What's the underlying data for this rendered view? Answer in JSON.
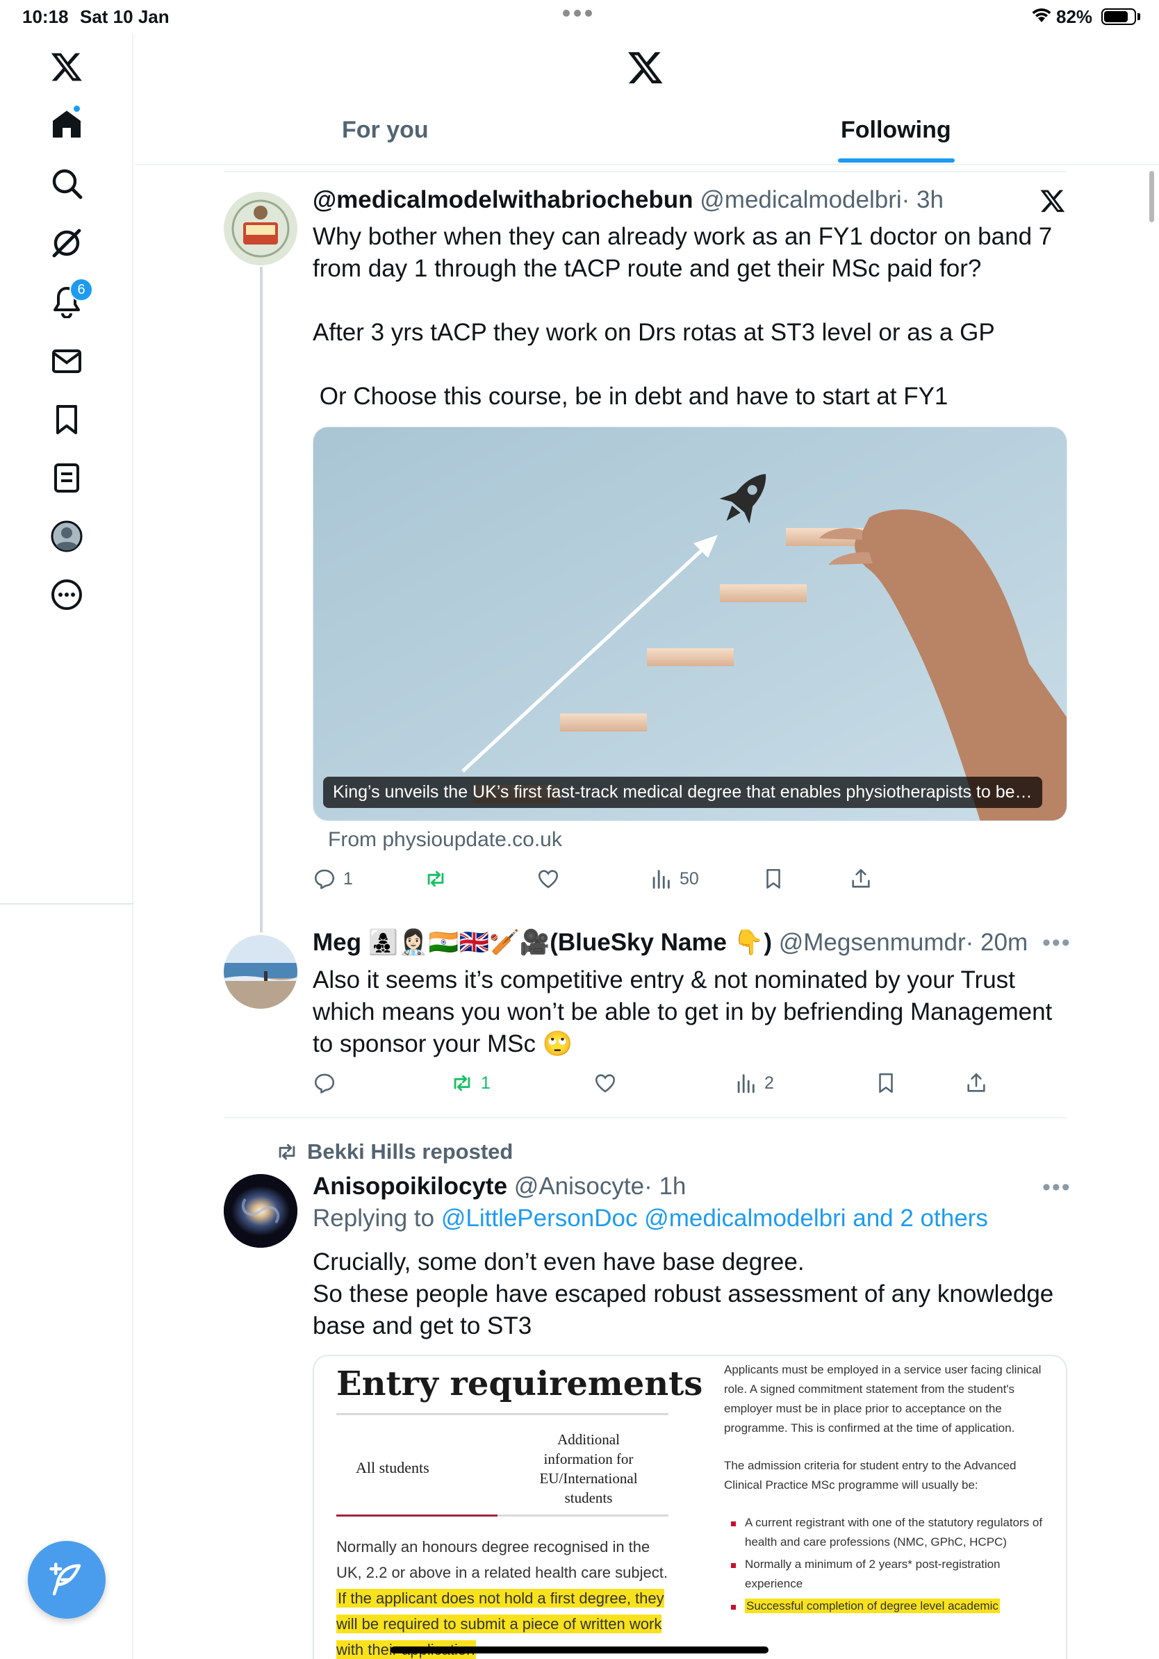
{
  "status_bar": {
    "time": "10:18",
    "date": "Sat 10 Jan",
    "battery_percent": "82%",
    "battery_level": 0.82
  },
  "sidebar": {
    "items": [
      {
        "icon": "x-logo-icon"
      },
      {
        "icon": "home-icon",
        "active": true
      },
      {
        "icon": "search-icon"
      },
      {
        "icon": "grok-icon"
      },
      {
        "icon": "bell-icon",
        "badge": "6"
      },
      {
        "icon": "mail-icon"
      },
      {
        "icon": "bookmark-icon"
      },
      {
        "icon": "lists-icon"
      },
      {
        "icon": "profile-icon"
      },
      {
        "icon": "more-icon"
      }
    ],
    "compose_icon": "compose-feather-icon"
  },
  "header": {
    "logo": "x-logo-icon",
    "tabs": [
      {
        "label": "For you",
        "active": false
      },
      {
        "label": "Following",
        "active": true
      }
    ]
  },
  "posts": [
    {
      "display_name": "@medicalmodelwithabriochebun",
      "handle": "@medicalmodelbri",
      "time": "· 3h",
      "text_lines": [
        "Why bother when they can already work as an FY1 doctor on band 7",
        "from day 1 through the tACP route and get their MSc paid for?",
        "",
        "After 3 yrs tACP they work on Drs rotas at ST3 level or as a GP",
        "",
        " Or Choose this course, be in debt and have to start at FY1"
      ],
      "card": {
        "caption": "King’s unveils the UK’s first fast-track medical degree that enables physiotherapists to be…",
        "source": "From physioupdate.co.uk"
      },
      "actions": {
        "replies": "1",
        "reposts": "",
        "likes": "",
        "views": "50"
      }
    },
    {
      "display_name": "Meg 👩‍👧‍👦👩🏻‍⚕️🇮🇳🇬🇧🏏🎥(BlueSky Name 👇)",
      "handle": "@Megsenmumdr",
      "time": "· 20m",
      "text_lines": [
        "Also it seems it’s competitive entry & not nominated by your Trust",
        "which means you won’t be able to get in by befriending Management",
        "to sponsor your MSc 🙄"
      ],
      "actions": {
        "replies": "",
        "reposts": "1",
        "likes": "",
        "views": "2"
      }
    },
    {
      "reposted_by": "Bekki Hills reposted",
      "display_name": "Anisopoikilocyte",
      "handle": "@Anisocyte",
      "time": "· 1h",
      "replying_to_prefix": "Replying to",
      "replying_to_links": "@LittlePersonDoc @medicalmodelbri and 2 others",
      "text_lines": [
        "Crucially, some don’t even have base degree.",
        "So these people have escaped robust assessment of any knowledge",
        "base and get to ST3"
      ],
      "doc": {
        "title": "Entry requirements",
        "col1_header": "All students",
        "col2_header": "Additional information for EU/International students",
        "para_plain": "Normally an honours degree recognised in the UK, 2.2 or above in a related health care subject.",
        "para_highlight": "If the applicant does not hold a first degree, they will be required to submit a piece of written work with their application",
        "right_para1": "Applicants must be employed in a service user facing clinical role. A signed commitment statement from the student's employer must be in place prior to acceptance on the programme. This is confirmed at the time of application.",
        "right_para2": "The admission criteria for student entry to the Advanced Clinical Practice MSc programme will usually be:",
        "right_bullets": [
          "A current registrant with one of the statutory regulators of health and care professions (NMC, GPhC, HCPC)",
          "Normally a minimum of 2 years* post-registration experience",
          "Successful completion of degree level academic"
        ]
      }
    }
  ],
  "colors": {
    "accent": "#1d9bf0",
    "repost_green": "#17bf63",
    "text_primary": "#0f1419",
    "text_secondary": "#536471",
    "highlight": "#f9e21b"
  }
}
